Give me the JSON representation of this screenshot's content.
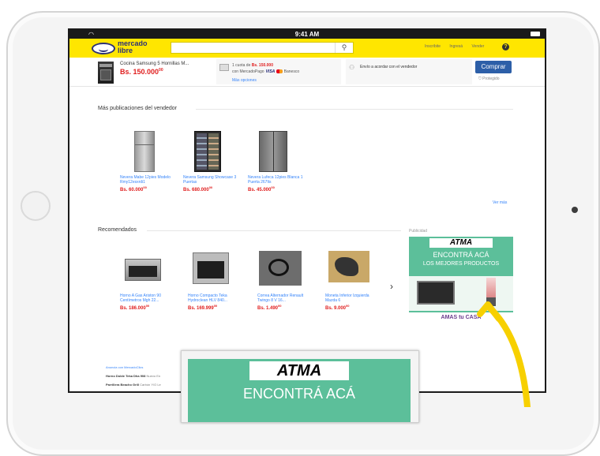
{
  "status": {
    "time": "9:41 AM"
  },
  "header": {
    "logo_text_line1": "mercado",
    "logo_text_line2": "libre",
    "search_placeholder": "",
    "links": [
      "Inscribite",
      "Ingresá",
      "Vender"
    ]
  },
  "product": {
    "name": "Cocina Samsung 5 Hornillas M...",
    "price": "Bs. 150.000",
    "price_cents": "00",
    "payment_line1_prefix": "1 cuota de",
    "payment_line1_value": "Bs. 150.000",
    "payment_line2_prefix": "con MercadoPago",
    "payment_visa": "VISA",
    "payment_extra": "Banesco",
    "payment_more": "Más opciones",
    "shipping": "Envío a acordar con el vendedor",
    "buy_label": "Comprar",
    "protect_label": "Protegido"
  },
  "more_section": {
    "title": "Más publicaciones del vendedor",
    "see_more": "Ver más",
    "items": [
      {
        "title": "Nevera Mabe 12pies Modelo Rmy12esxrdi1",
        "price": "Bs. 60.000",
        "cents": "00"
      },
      {
        "title": "Nevera Samsung Showcase 3 Puertas",
        "price": "Bs. 680.000",
        "cents": "00"
      },
      {
        "title": "Nevera Lufeca 12pies Blanca 1 Puerta 267lts",
        "price": "Bs. 45.000",
        "cents": "00"
      }
    ]
  },
  "recommended": {
    "title": "Recomendados",
    "items": [
      {
        "title": "Horno A Gas Ariston 90 Centímetros Mgh 22...",
        "price": "Bs. 186.000",
        "cents": "00"
      },
      {
        "title": "Horno Compacto Teka Hydroclean HLV 840...",
        "price": "Bs. 169.999",
        "cents": "00"
      },
      {
        "title": "Correa Alternador Renault Twingo 8 V 16...",
        "price": "Bs. 1.490",
        "cents": "00"
      },
      {
        "title": "Moneta Inferior Izquierda Mazda 6",
        "price": "Bs. 9.000",
        "cents": "00"
      }
    ],
    "next_arrow": "›"
  },
  "ad": {
    "label": "Publicidad",
    "brand": "ATMA",
    "headline": "ENCONTRÁ ACÁ",
    "subline": "LOS MEJORES PRODUCTOS",
    "slogan": "AMAS tu CASA"
  },
  "footer": {
    "line1": "Anuncia con MercadoClics",
    "line2_bold": "Horno Doble Teka Dha 908",
    "line2_rest": "Nuevo En",
    "line3_bold": "Parrillera Beacho Grill",
    "line3_rest": "Carbón Y/O Le"
  },
  "zoom": {
    "brand": "ATMA",
    "headline": "ENCONTRÁ ACÁ"
  },
  "colors": {
    "header_yellow": "#ffe600",
    "buy_blue": "#2d5fa8",
    "price_red": "#e02020",
    "ad_green": "#5cbf9a",
    "arrow_yellow": "#f7d000"
  }
}
